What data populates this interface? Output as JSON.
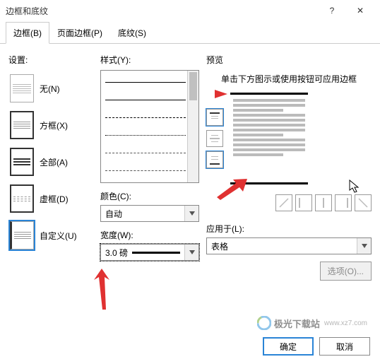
{
  "window": {
    "title": "边框和底纹",
    "help": "?",
    "close": "✕"
  },
  "tabs": {
    "borders": "边框(B)",
    "page_borders": "页面边框(P)",
    "shading": "底纹(S)"
  },
  "settings": {
    "label": "设置:",
    "none": "无(N)",
    "box": "方框(X)",
    "all": "全部(A)",
    "grid": "虚框(D)",
    "custom": "自定义(U)"
  },
  "style": {
    "label": "样式(Y):"
  },
  "color": {
    "label": "颜色(C):",
    "value": "自动"
  },
  "width": {
    "label": "宽度(W):",
    "value": "3.0 磅"
  },
  "preview": {
    "label": "预览",
    "hint": "单击下方图示或使用按钮可应用边框"
  },
  "apply": {
    "label": "应用于(L):",
    "value": "表格"
  },
  "options_btn": "选项(O)...",
  "ok": "确定",
  "cancel": "取消",
  "watermark": {
    "text": "极光下载站",
    "url": "www.xz7.com"
  }
}
